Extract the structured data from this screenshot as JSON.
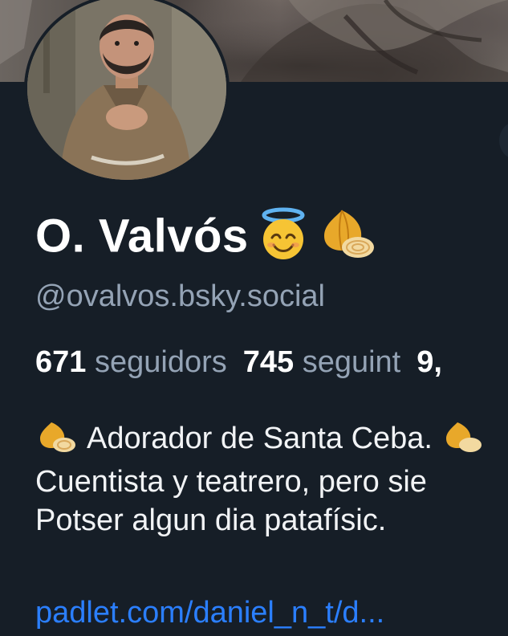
{
  "profile": {
    "display_name": "O. Valvós",
    "handle": "@ovalvos.bsky.social",
    "name_emojis": [
      "smiling-face-with-halo-icon",
      "onion-icon"
    ]
  },
  "stats": {
    "followers_count": "671",
    "followers_label": "seguidors",
    "following_count": "745",
    "following_label": "seguint",
    "posts_count": "9,"
  },
  "bio": {
    "line1": "Adorador de Santa Ceba.",
    "line2": " Cuentista y teatrero, pero sie",
    "line3": "Potser algun dia patafísic."
  },
  "link": {
    "text": "padlet.com/daniel_n_t/d..."
  },
  "colors": {
    "background": "#161e27",
    "text_primary": "#ffffff",
    "text_secondary": "#94a3b5",
    "link": "#2b7fff"
  }
}
